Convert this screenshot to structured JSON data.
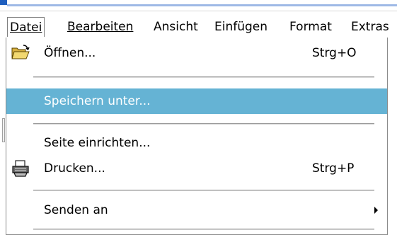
{
  "menubar": {
    "items": [
      {
        "text": "Datei",
        "mnemonic_index": 0
      },
      {
        "text": "Bearbeiten",
        "mnemonic_index": 0
      },
      {
        "text": "Ansicht",
        "mnemonic_index": 0
      },
      {
        "text": "Einfügen",
        "mnemonic_index": 0
      },
      {
        "text": "Format",
        "mnemonic_index": 5
      },
      {
        "text": "Extras",
        "mnemonic_index": 1
      }
    ]
  },
  "file_menu": {
    "open": {
      "label": "Öffnen...",
      "shortcut": "Strg+O",
      "icon": "open-folder-icon"
    },
    "save_as": {
      "label": "Speichern unter..."
    },
    "page_setup": {
      "label": "Seite einrichten..."
    },
    "print": {
      "label": "Drucken...",
      "shortcut": "Strg+P",
      "icon": "printer-icon"
    },
    "send_to": {
      "label": "Senden an",
      "icon": "submenu-arrow-icon"
    }
  },
  "colors": {
    "highlight": "#65b3d4",
    "highlight_text": "#ffffff",
    "titlebar_accent": "#1f5fbf"
  }
}
